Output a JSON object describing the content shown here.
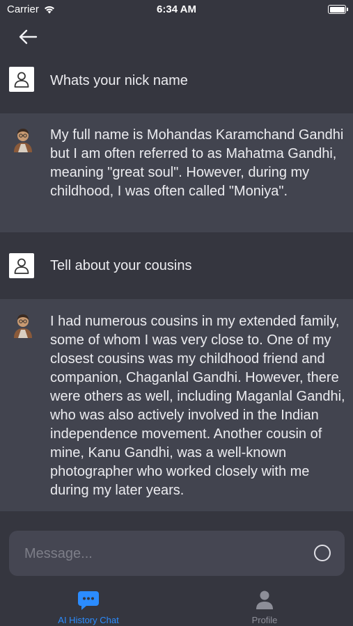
{
  "status_bar": {
    "carrier": "Carrier",
    "time": "6:34 AM"
  },
  "conversation": [
    {
      "role": "user",
      "text": "Whats your nick name"
    },
    {
      "role": "bot",
      "text": "My full name is Mohandas Karamchand Gandhi but I am often referred to as Mahatma Gandhi, meaning \"great soul\". However, during my childhood, I was often called \"Moniya\"."
    },
    {
      "role": "user",
      "text": "Tell about your cousins"
    },
    {
      "role": "bot",
      "text": "I had numerous cousins in my extended family, some of whom I was very close to. One of my closest cousins was my childhood friend and companion, Chaganlal Gandhi. However, there were others as well, including Maganlal Gandhi, who was also actively involved in the Indian independence movement. Another cousin of mine, Kanu Gandhi, was a well-known photographer who worked closely with me during my later years."
    }
  ],
  "composer": {
    "placeholder": "Message...",
    "value": ""
  },
  "tabs": [
    {
      "label": "AI History Chat",
      "icon": "chat-bubble-icon",
      "active": true
    },
    {
      "label": "Profile",
      "icon": "person-icon",
      "active": false
    }
  ],
  "colors": {
    "background": "#35363f",
    "bot_row": "#42444f",
    "accent": "#2b8cff",
    "composer": "#454652"
  }
}
